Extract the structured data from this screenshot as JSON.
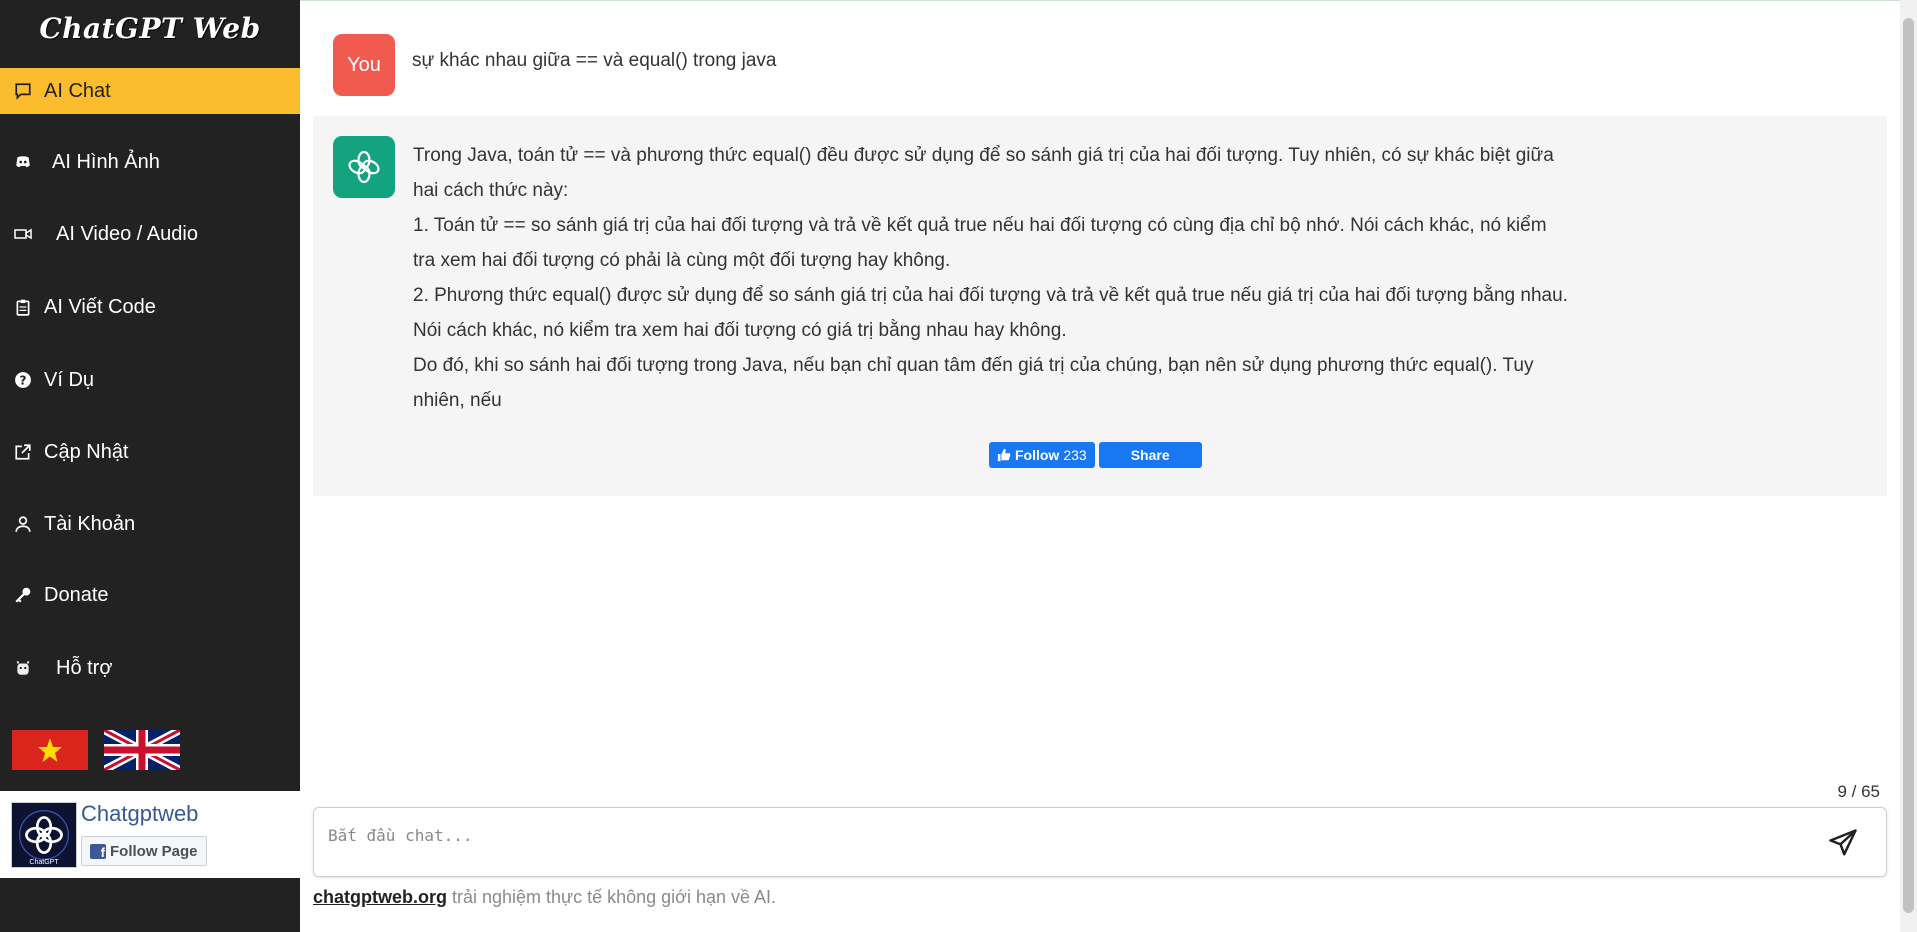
{
  "sidebar": {
    "brand": "ChatGPT Web",
    "items": [
      {
        "label": "AI Chat",
        "icon": "chat-bubble-icon"
      },
      {
        "label": "AI Hình Ảnh",
        "icon": "discord-icon"
      },
      {
        "label": "AI Video / Audio",
        "icon": "video-camera-icon"
      },
      {
        "label": "AI Viết Code",
        "icon": "clipboard-icon"
      },
      {
        "label": "Ví Dụ",
        "icon": "question-circle-icon"
      },
      {
        "label": "Cập Nhật",
        "icon": "external-link-icon"
      },
      {
        "label": "Tài Khoản",
        "icon": "user-icon"
      },
      {
        "label": "Donate",
        "icon": "key-icon"
      },
      {
        "label": "Hỗ trợ",
        "icon": "support-icon"
      }
    ],
    "flags": [
      "vietnam-flag",
      "uk-flag"
    ],
    "fb_page": {
      "name": "Chatgptweb",
      "follow_label": "Follow Page",
      "logo_caption": "ChatGPT"
    }
  },
  "chat": {
    "user_avatar": "You",
    "user_message": "sự khác nhau giữa == và equal() trong java",
    "bot_paragraphs": [
      "Trong Java, toán tử == và phương thức equal() đều được sử dụng để so sánh giá trị của hai đối tượng. Tuy nhiên, có sự khác biệt giữa hai cách thức này:",
      "1. Toán tử == so sánh giá trị của hai đối tượng và trả về kết quả true nếu hai đối tượng có cùng địa chỉ bộ nhớ. Nói cách khác, nó kiểm tra xem hai đối tượng có phải là cùng một đối tượng hay không.",
      "2. Phương thức equal() được sử dụng để so sánh giá trị của hai đối tượng và trả về kết quả true nếu giá trị của hai đối tượng bằng nhau. Nói cách khác, nó kiểm tra xem hai đối tượng có giá trị bằng nhau hay không.",
      "Do đó, khi so sánh hai đối tượng trong Java, nếu bạn chỉ quan tâm đến giá trị của chúng, bạn nên sử dụng phương thức equal(). Tuy nhiên, nếu"
    ],
    "follow_label": "Follow",
    "follow_count": "233",
    "share_label": "Share"
  },
  "composer": {
    "counter": "9 / 65",
    "placeholder": "Bắt đầu chat...",
    "value": ""
  },
  "footer": {
    "link": "chatgptweb.org",
    "text": " trải nghiệm thực tế không giới hạn về AI."
  },
  "colors": {
    "sidebar_bg": "#222222",
    "active_item": "#fbbc2e",
    "you_avatar": "#f05a4f",
    "gpt_avatar": "#13a37f",
    "facebook_blue": "#1877f2"
  }
}
